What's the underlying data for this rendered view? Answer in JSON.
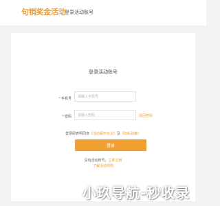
{
  "header": {
    "brand": "句销奖金活动",
    "subtitle": "登录活动账号"
  },
  "form": {
    "title": "登录活动账号",
    "required_mark": "*",
    "phone_label": "手机号",
    "phone_placeholder": "请输入手机号",
    "password_label": "密码",
    "password_placeholder": "请输入密码",
    "forgot_password": "找回密码",
    "agreement_prefix": "登录即表明同意",
    "agreement_link1": "《活动服务协议》",
    "agreement_and": "及",
    "agreement_link2": "《隐私政策》",
    "login_button": "登录",
    "register_prefix": "没有活动账号，",
    "register_link": "立即注册",
    "learn_more": "了解活动规则"
  },
  "watermark": "小玖导航-秒收录",
  "colors": {
    "accent": "#f0a033",
    "background": "#f2f2f2",
    "required": "#e64340"
  }
}
